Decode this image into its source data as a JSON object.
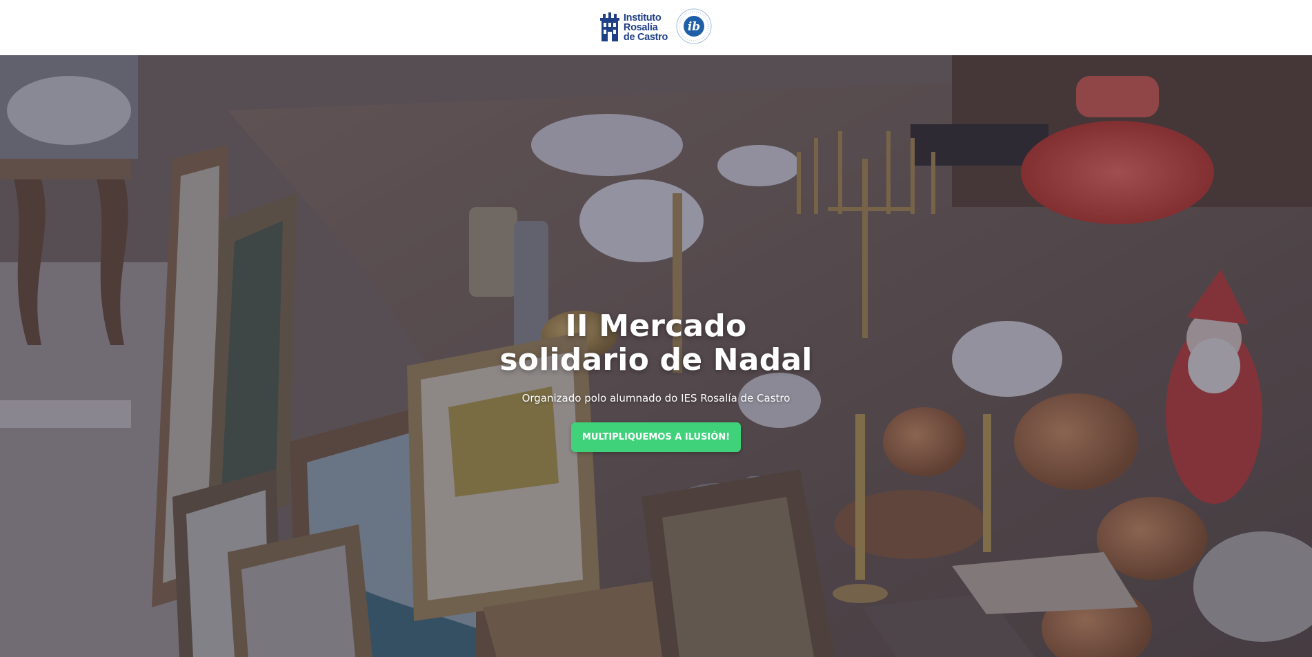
{
  "header": {
    "brand_lines": [
      "Instituto",
      "Rosalía",
      "de Castro"
    ],
    "logo_icon": "school-building-icon",
    "ib_logo_text": "ib",
    "ib_icon": "ib-logo-icon",
    "brand_color": "#1f3f86"
  },
  "hero": {
    "title_lines": [
      "II Mercado",
      "solidario de Nadal"
    ],
    "subtitle": "Organizado polo alumnado do IES Rosalía de Castro",
    "cta_label": "MULTIPLIQUEMOS A ILUSIÓN!",
    "cta_color": "#3fd27a",
    "background": "flea-market-antiques-photo"
  }
}
